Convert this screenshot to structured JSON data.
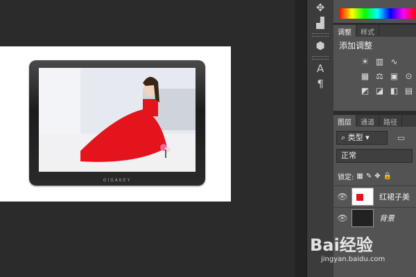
{
  "canvas": {
    "brand_text": "GIGAKEY"
  },
  "tools": {
    "items": [
      "move-icon",
      "shapes-icon",
      "cube-icon",
      "text-tool-icon",
      "paragraph-icon"
    ]
  },
  "adjustments": {
    "tabs": [
      "调整",
      "样式"
    ],
    "title": "添加调整",
    "icons_row1": [
      "brightness-icon",
      "levels-icon",
      "curves-icon"
    ],
    "icons_row2": [
      "vibrance-icon",
      "balance-icon",
      "photo-filter-icon",
      "channel-mixer-icon"
    ],
    "icons_row3": [
      "invert-icon",
      "posterize-icon",
      "threshold-icon",
      "gradient-map-icon"
    ]
  },
  "layers": {
    "tabs": [
      "图层",
      "通道",
      "路径"
    ],
    "filter_label": "类型",
    "blend_mode": "正常",
    "lock_label": "锁定:",
    "items": [
      {
        "name": "红裙子美",
        "selected": true
      },
      {
        "name": "背景",
        "selected": false
      }
    ]
  },
  "watermark": {
    "brand": "Bai经验",
    "url": "jingyan.baidu.com"
  }
}
